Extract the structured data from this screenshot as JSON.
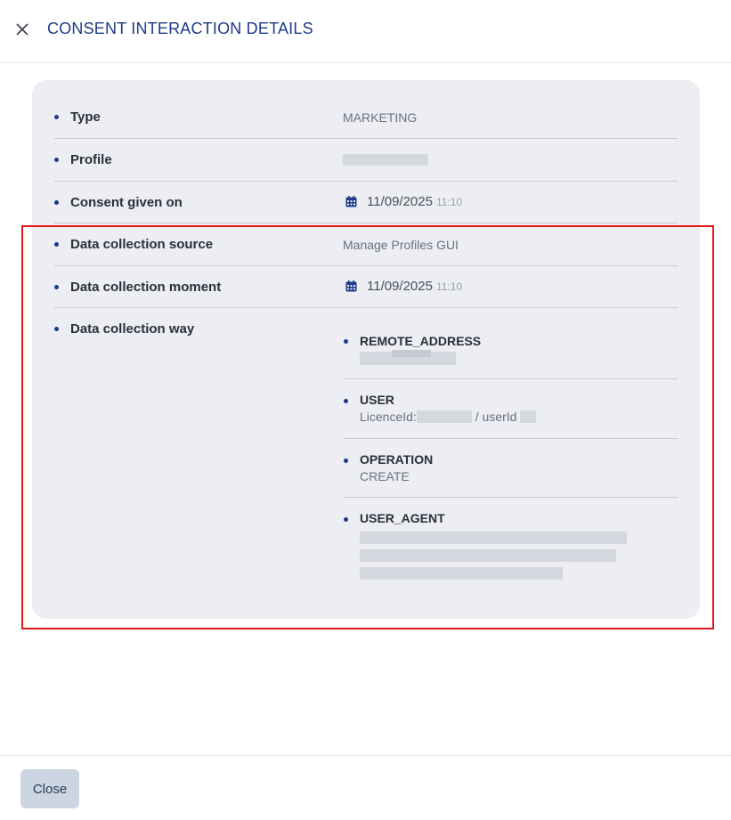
{
  "header": {
    "title": "CONSENT INTERACTION DETAILS",
    "close_icon": "close-icon"
  },
  "rows": [
    {
      "label": "Type",
      "value": "MARKETING"
    },
    {
      "label": "Profile",
      "value": ""
    },
    {
      "label": "Consent given on",
      "date": "11/09/2025",
      "time": "11:10",
      "icon": "calendar-icon"
    },
    {
      "label": "Data collection source",
      "value": "Manage Profiles GUI"
    },
    {
      "label": "Data collection moment",
      "date": "11/09/2025",
      "time": "11:10",
      "icon": "calendar-icon"
    },
    {
      "label": "Data collection way"
    }
  ],
  "collection_way": [
    {
      "key": "REMOTE_ADDRESS",
      "value": ""
    },
    {
      "key": "USER",
      "value_prefix": "LicenceId:",
      "value_middle": "/ userId"
    },
    {
      "key": "OPERATION",
      "value": "CREATE"
    },
    {
      "key": "USER_AGENT",
      "value": ""
    }
  ],
  "footer": {
    "close_label": "Close"
  },
  "colors": {
    "accent": "#1e3a8a",
    "card_bg": "#eceef3",
    "highlight_border": "#e01818",
    "button_bg": "#ccd6e2"
  }
}
